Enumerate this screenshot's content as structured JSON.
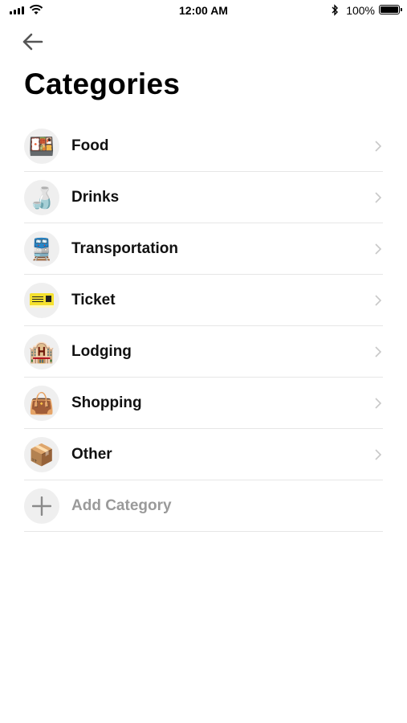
{
  "status_bar": {
    "time": "12:00 AM",
    "battery": "100%"
  },
  "header": {
    "back_icon": "arrow-left-icon",
    "title": "Categories"
  },
  "categories": [
    {
      "label": "Food",
      "icon": "bento-box-icon",
      "emoji": "🍱"
    },
    {
      "label": "Drinks",
      "icon": "sake-icon",
      "emoji": "🍶"
    },
    {
      "label": "Transportation",
      "icon": "train-icon",
      "emoji": "🚆"
    },
    {
      "label": "Ticket",
      "icon": "ticket-icon",
      "emoji": ""
    },
    {
      "label": "Lodging",
      "icon": "hotel-icon",
      "emoji": "🏨"
    },
    {
      "label": "Shopping",
      "icon": "handbag-icon",
      "emoji": "👜"
    },
    {
      "label": "Other",
      "icon": "package-icon",
      "emoji": "📦"
    }
  ],
  "add_category": {
    "label": "Add Category",
    "icon": "plus-icon"
  },
  "colors": {
    "text": "#111111",
    "muted": "#9a9a9a",
    "divider": "#e6e6e6",
    "icon_bg": "#efefef"
  }
}
